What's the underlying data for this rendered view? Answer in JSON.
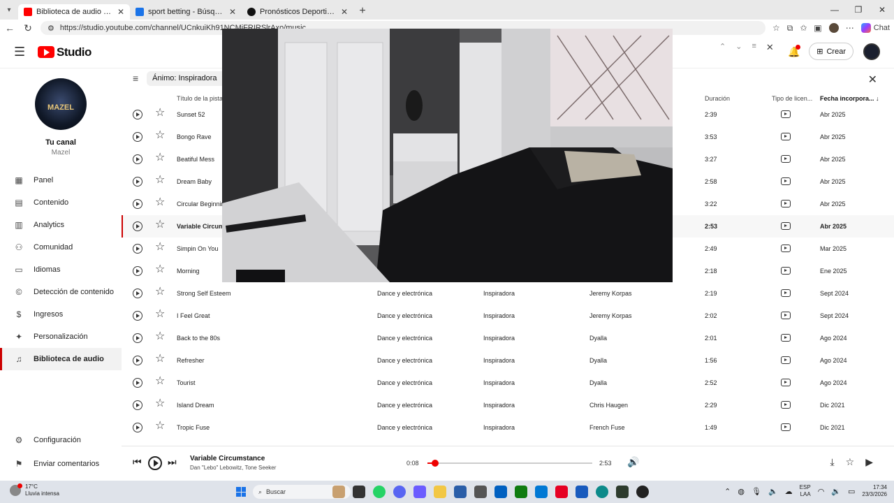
{
  "browser": {
    "tabs": [
      {
        "title": "Biblioteca de audio - YouTube Stu",
        "active": true,
        "favicon_color": "#ff0000"
      },
      {
        "title": "sport betting - Búsqueda",
        "active": false,
        "favicon_color": "#1a73e8"
      },
      {
        "title": "Pronósticos Deportivos",
        "active": false,
        "favicon_color": "#111111"
      }
    ],
    "url": "https://studio.youtube.com/channel/UCnkuiKh91NCMjFRIRSlrAxo/music"
  },
  "header": {
    "logo_text": "Studio",
    "create_label": "Crear",
    "copilot_label": "Chat"
  },
  "channel": {
    "avatar_text": "MAZEL",
    "title": "Tu canal",
    "handle": "Mazel"
  },
  "sidebar": {
    "items": [
      {
        "label": "Panel",
        "icon": "dashboard-icon"
      },
      {
        "label": "Contenido",
        "icon": "content-icon"
      },
      {
        "label": "Analytics",
        "icon": "analytics-icon"
      },
      {
        "label": "Comunidad",
        "icon": "community-icon"
      },
      {
        "label": "Idiomas",
        "icon": "subtitles-icon"
      },
      {
        "label": "Detección de contenido",
        "icon": "copyright-icon"
      },
      {
        "label": "Ingresos",
        "icon": "dollar-icon"
      },
      {
        "label": "Personalización",
        "icon": "magic-wand-icon"
      },
      {
        "label": "Biblioteca de audio",
        "icon": "audio-library-icon",
        "active": true
      }
    ],
    "bottom": [
      {
        "label": "Configuración",
        "icon": "gear-icon"
      },
      {
        "label": "Enviar comentarios",
        "icon": "feedback-icon"
      }
    ]
  },
  "filters": {
    "chip": "Ánimo: Inspiradora"
  },
  "table": {
    "headers": {
      "title": "Título de la pista",
      "duration": "Duración",
      "license": "Tipo de licen...",
      "date": "Fecha incorpora..."
    },
    "rows": [
      {
        "title": "Sunset 52",
        "genre": "",
        "mood": "",
        "artist": "",
        "duration": "2:39",
        "date": "Abr 2025"
      },
      {
        "title": "Bongo Rave",
        "genre": "",
        "mood": "",
        "artist": "",
        "duration": "3:53",
        "date": "Abr 2025"
      },
      {
        "title": "Beatiful Mess",
        "genre": "",
        "mood": "",
        "artist": "",
        "duration": "3:27",
        "date": "Abr 2025"
      },
      {
        "title": "Dream Baby",
        "genre": "",
        "mood": "",
        "artist": "",
        "duration": "2:58",
        "date": "Abr 2025"
      },
      {
        "title": "Circular Beginnin",
        "genre": "",
        "mood": "",
        "artist": "",
        "duration": "3:22",
        "date": "Abr 2025"
      },
      {
        "title": "Variable Circums",
        "genre": "",
        "mood": "",
        "artist": "",
        "duration": "2:53",
        "date": "Abr 2025",
        "active": true
      },
      {
        "title": "Simpin On You",
        "genre": "",
        "mood": "",
        "artist": "",
        "duration": "2:49",
        "date": "Mar 2025"
      },
      {
        "title": "Morning",
        "genre": "",
        "mood": "",
        "artist": "",
        "duration": "2:18",
        "date": "Ene 2025"
      },
      {
        "title": "Strong Self Esteem",
        "genre": "Dance y electrónica",
        "mood": "Inspiradora",
        "artist": "Jeremy Korpas",
        "duration": "2:19",
        "date": "Sept 2024"
      },
      {
        "title": "I Feel Great",
        "genre": "Dance y electrónica",
        "mood": "Inspiradora",
        "artist": "Jeremy Korpas",
        "duration": "2:02",
        "date": "Sept 2024"
      },
      {
        "title": "Back to the 80s",
        "genre": "Dance y electrónica",
        "mood": "Inspiradora",
        "artist": "Dyalla",
        "duration": "2:01",
        "date": "Ago 2024"
      },
      {
        "title": "Refresher",
        "genre": "Dance y electrónica",
        "mood": "Inspiradora",
        "artist": "Dyalla",
        "duration": "1:56",
        "date": "Ago 2024"
      },
      {
        "title": "Tourist",
        "genre": "Dance y electrónica",
        "mood": "Inspiradora",
        "artist": "Dyalla",
        "duration": "2:52",
        "date": "Ago 2024"
      },
      {
        "title": "Island Dream",
        "genre": "Dance y electrónica",
        "mood": "Inspiradora",
        "artist": "Chris Haugen",
        "duration": "2:29",
        "date": "Dic 2021"
      },
      {
        "title": "Tropic Fuse",
        "genre": "Dance y electrónica",
        "mood": "Inspiradora",
        "artist": "French Fuse",
        "duration": "1:49",
        "date": "Dic 2021"
      }
    ]
  },
  "player": {
    "title": "Variable Circumstance",
    "artist": "Dan \"Lebo\" Lebowitz, Tone Seeker",
    "current": "0:08",
    "total": "2:53",
    "progress": 0.046
  },
  "taskbar": {
    "temp": "17°C",
    "weather": "Lluvia intensa",
    "search": "Buscar",
    "lang": "ESP",
    "lang2": "LAA",
    "time": "17:34",
    "date": "23/3/2026"
  },
  "colors": {
    "accent": "#ff0000",
    "taskbar": "#dfe3ea"
  }
}
